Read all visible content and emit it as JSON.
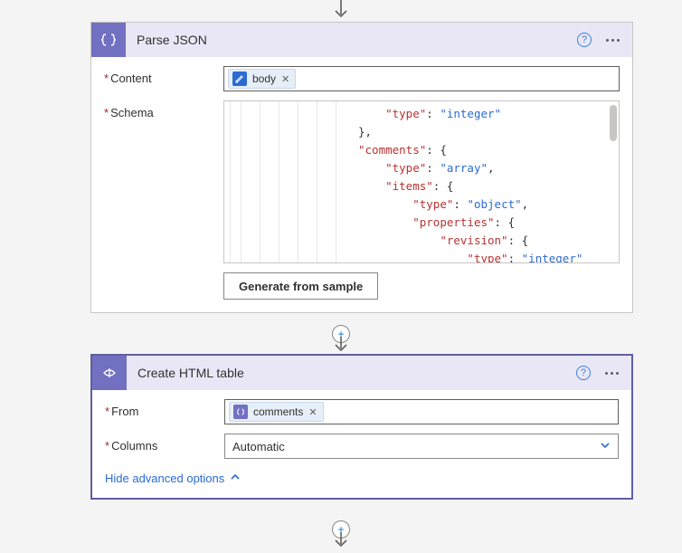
{
  "parse": {
    "title": "Parse JSON",
    "contentLabel": "Content",
    "schemaLabel": "Schema",
    "token": {
      "label": "body",
      "icon": "dynamic-content-icon"
    },
    "generateButton": "Generate from sample",
    "code": {
      "l1a": "\"type\"",
      "l1b": "\"integer\"",
      "l3a": "\"comments\"",
      "l4a": "\"type\"",
      "l4b": "\"array\"",
      "l5a": "\"items\"",
      "l6a": "\"type\"",
      "l6b": "\"object\"",
      "l7a": "\"properties\"",
      "l8a": "\"revision\"",
      "l9a": "\"type\"",
      "l9b": "\"integer\""
    }
  },
  "table": {
    "title": "Create HTML table",
    "fromLabel": "From",
    "columnsLabel": "Columns",
    "token": {
      "label": "comments",
      "icon": "parse-json-icon"
    },
    "columnsValue": "Automatic",
    "advancedLink": "Hide advanced options"
  }
}
